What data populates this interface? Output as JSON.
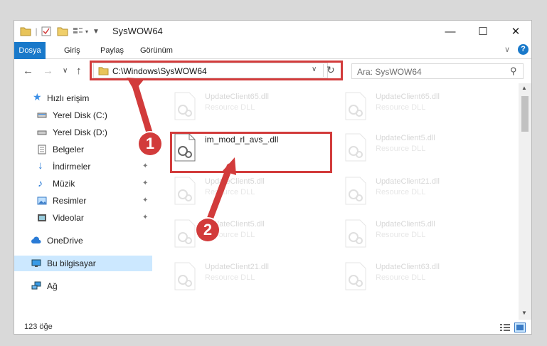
{
  "window": {
    "title": "SysWOW64"
  },
  "ribbon": {
    "tabs": [
      "Dosya",
      "Giriş",
      "Paylaş",
      "Görünüm"
    ]
  },
  "address": {
    "path": "C:\\Windows\\SysWOW64"
  },
  "search": {
    "placeholder": "Ara: SysWOW64"
  },
  "sidebar": {
    "items": [
      {
        "label": "Hızlı erişim",
        "icon": "star-icon"
      },
      {
        "label": "Yerel Disk (C:)",
        "icon": "drive-icon"
      },
      {
        "label": "Yerel Disk (D:)",
        "icon": "drive-icon"
      },
      {
        "label": "Belgeler",
        "icon": "documents-icon"
      },
      {
        "label": "İndirmeler",
        "icon": "download-icon"
      },
      {
        "label": "Müzik",
        "icon": "music-icon"
      },
      {
        "label": "Resimler",
        "icon": "pictures-icon"
      },
      {
        "label": "Videolar",
        "icon": "video-icon"
      },
      {
        "label": "OneDrive",
        "icon": "cloud-icon"
      },
      {
        "label": "Bu bilgisayar",
        "icon": "computer-icon"
      },
      {
        "label": "Ağ",
        "icon": "network-icon"
      }
    ]
  },
  "files": [
    {
      "name": "UpdateClient65.dll",
      "type": "Resource DLL"
    },
    {
      "name": "UpdateClient65.dll",
      "type": "Resource DLL"
    },
    {
      "name": "im_mod_rl_avs_.dll",
      "type": ""
    },
    {
      "name": "UpdateClient5.dll",
      "type": "Resource DLL"
    },
    {
      "name": "UpdateClient5.dll",
      "type": "Resource DLL"
    },
    {
      "name": "UpdateClient21.dll",
      "type": "Resource DLL"
    },
    {
      "name": "UpdateClient5.dll",
      "type": "Resource DLL"
    },
    {
      "name": "UpdateClient5.dll",
      "type": "Resource DLL"
    },
    {
      "name": "UpdateClient21.dll",
      "type": "Resource DLL"
    },
    {
      "name": "UpdateClient63.dll",
      "type": "Resource DLL"
    }
  ],
  "status": {
    "count": "123 öğe"
  },
  "callouts": [
    "1",
    "2"
  ],
  "colors": {
    "accent": "#1979ca",
    "highlight": "#d23b3b",
    "selected": "#cce8ff"
  }
}
